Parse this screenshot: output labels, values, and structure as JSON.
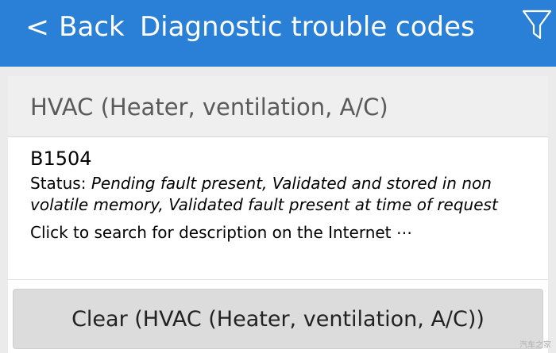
{
  "header": {
    "back_chevron": "<",
    "back_label": "Back",
    "title": "Diagnostic trouble codes",
    "filter_icon": "filter-icon",
    "background_color": "#2a80d6"
  },
  "section": {
    "title": "HVAC (Heater, ventilation, A/C)"
  },
  "trouble_codes": [
    {
      "code": "B1504",
      "status_label": "Status: ",
      "status_value": "Pending fault present, Validated and stored in non volatile memory, Validated fault present at time of request",
      "search_link": "Click to search for description on the Internet ⋯"
    }
  ],
  "actions": {
    "clear_label": "Clear (HVAC (Heater, ventilation, A/C))"
  },
  "watermark": "汽车之家"
}
